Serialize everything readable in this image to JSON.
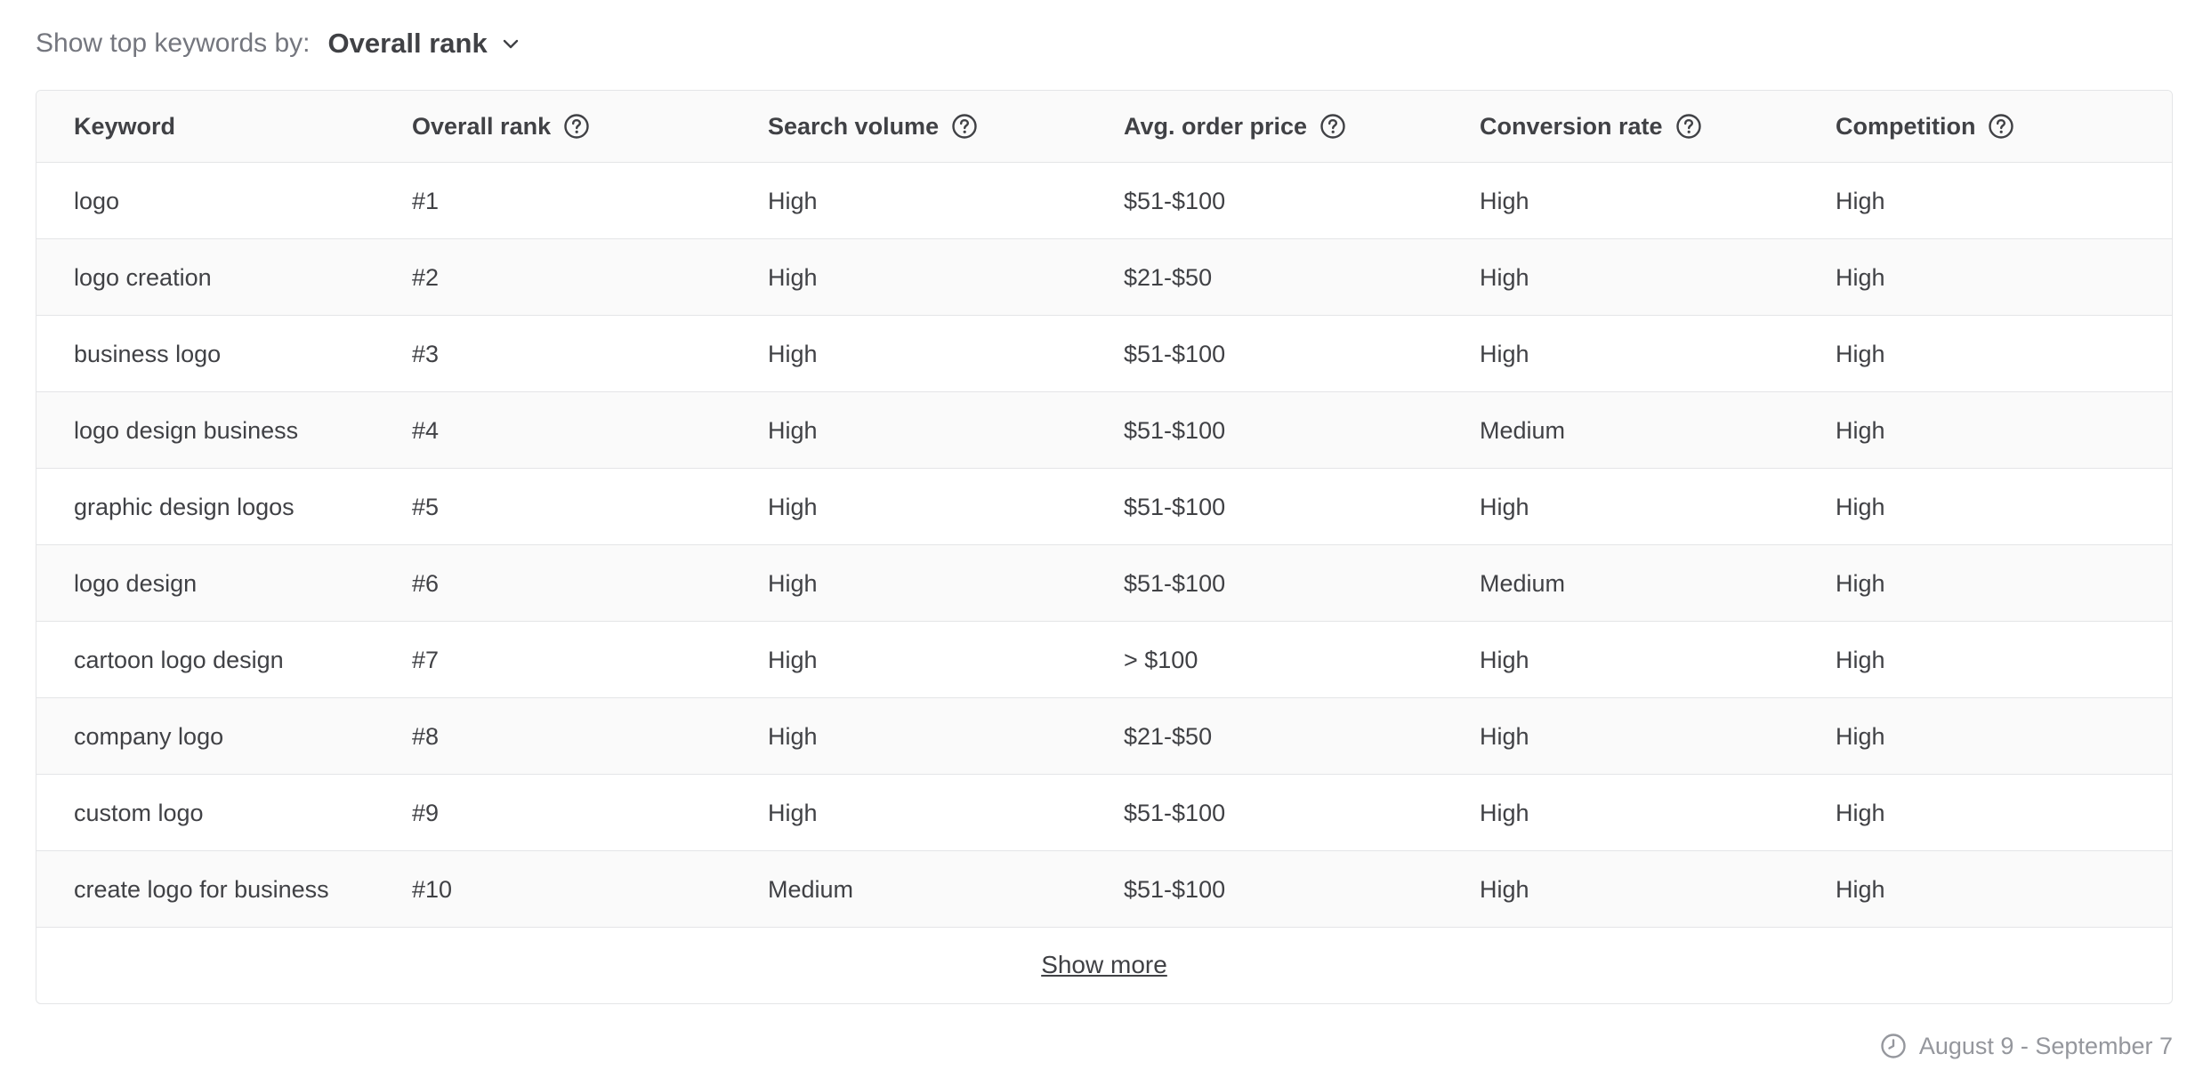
{
  "filter": {
    "label": "Show top keywords by:",
    "selected": "Overall rank"
  },
  "table": {
    "headers": [
      "Keyword",
      "Overall rank",
      "Search volume",
      "Avg. order price",
      "Conversion rate",
      "Competition"
    ],
    "rows": [
      [
        "logo",
        "#1",
        "High",
        "$51-$100",
        "High",
        "High"
      ],
      [
        "logo creation",
        "#2",
        "High",
        "$21-$50",
        "High",
        "High"
      ],
      [
        "business logo",
        "#3",
        "High",
        "$51-$100",
        "High",
        "High"
      ],
      [
        "logo design business",
        "#4",
        "High",
        "$51-$100",
        "Medium",
        "High"
      ],
      [
        "graphic design logos",
        "#5",
        "High",
        "$51-$100",
        "High",
        "High"
      ],
      [
        "logo design",
        "#6",
        "High",
        "$51-$100",
        "Medium",
        "High"
      ],
      [
        "cartoon logo design",
        "#7",
        "High",
        "> $100",
        "High",
        "High"
      ],
      [
        "company logo",
        "#8",
        "High",
        "$21-$50",
        "High",
        "High"
      ],
      [
        "custom logo",
        "#9",
        "High",
        "$51-$100",
        "High",
        "High"
      ],
      [
        "create logo for business",
        "#10",
        "Medium",
        "$51-$100",
        "High",
        "High"
      ]
    ],
    "show_more": "Show more"
  },
  "date_range": "August 9 - September 7",
  "icons": {
    "dropdown": "chevron-down-icon",
    "help": "question-circle-icon",
    "clock": "clock-icon"
  },
  "colors": {
    "text_primary": "#404145",
    "text_secondary": "#74767e",
    "text_muted": "#95979d",
    "border": "#e4e5e7",
    "row_alt_bg": "#fafafa"
  }
}
